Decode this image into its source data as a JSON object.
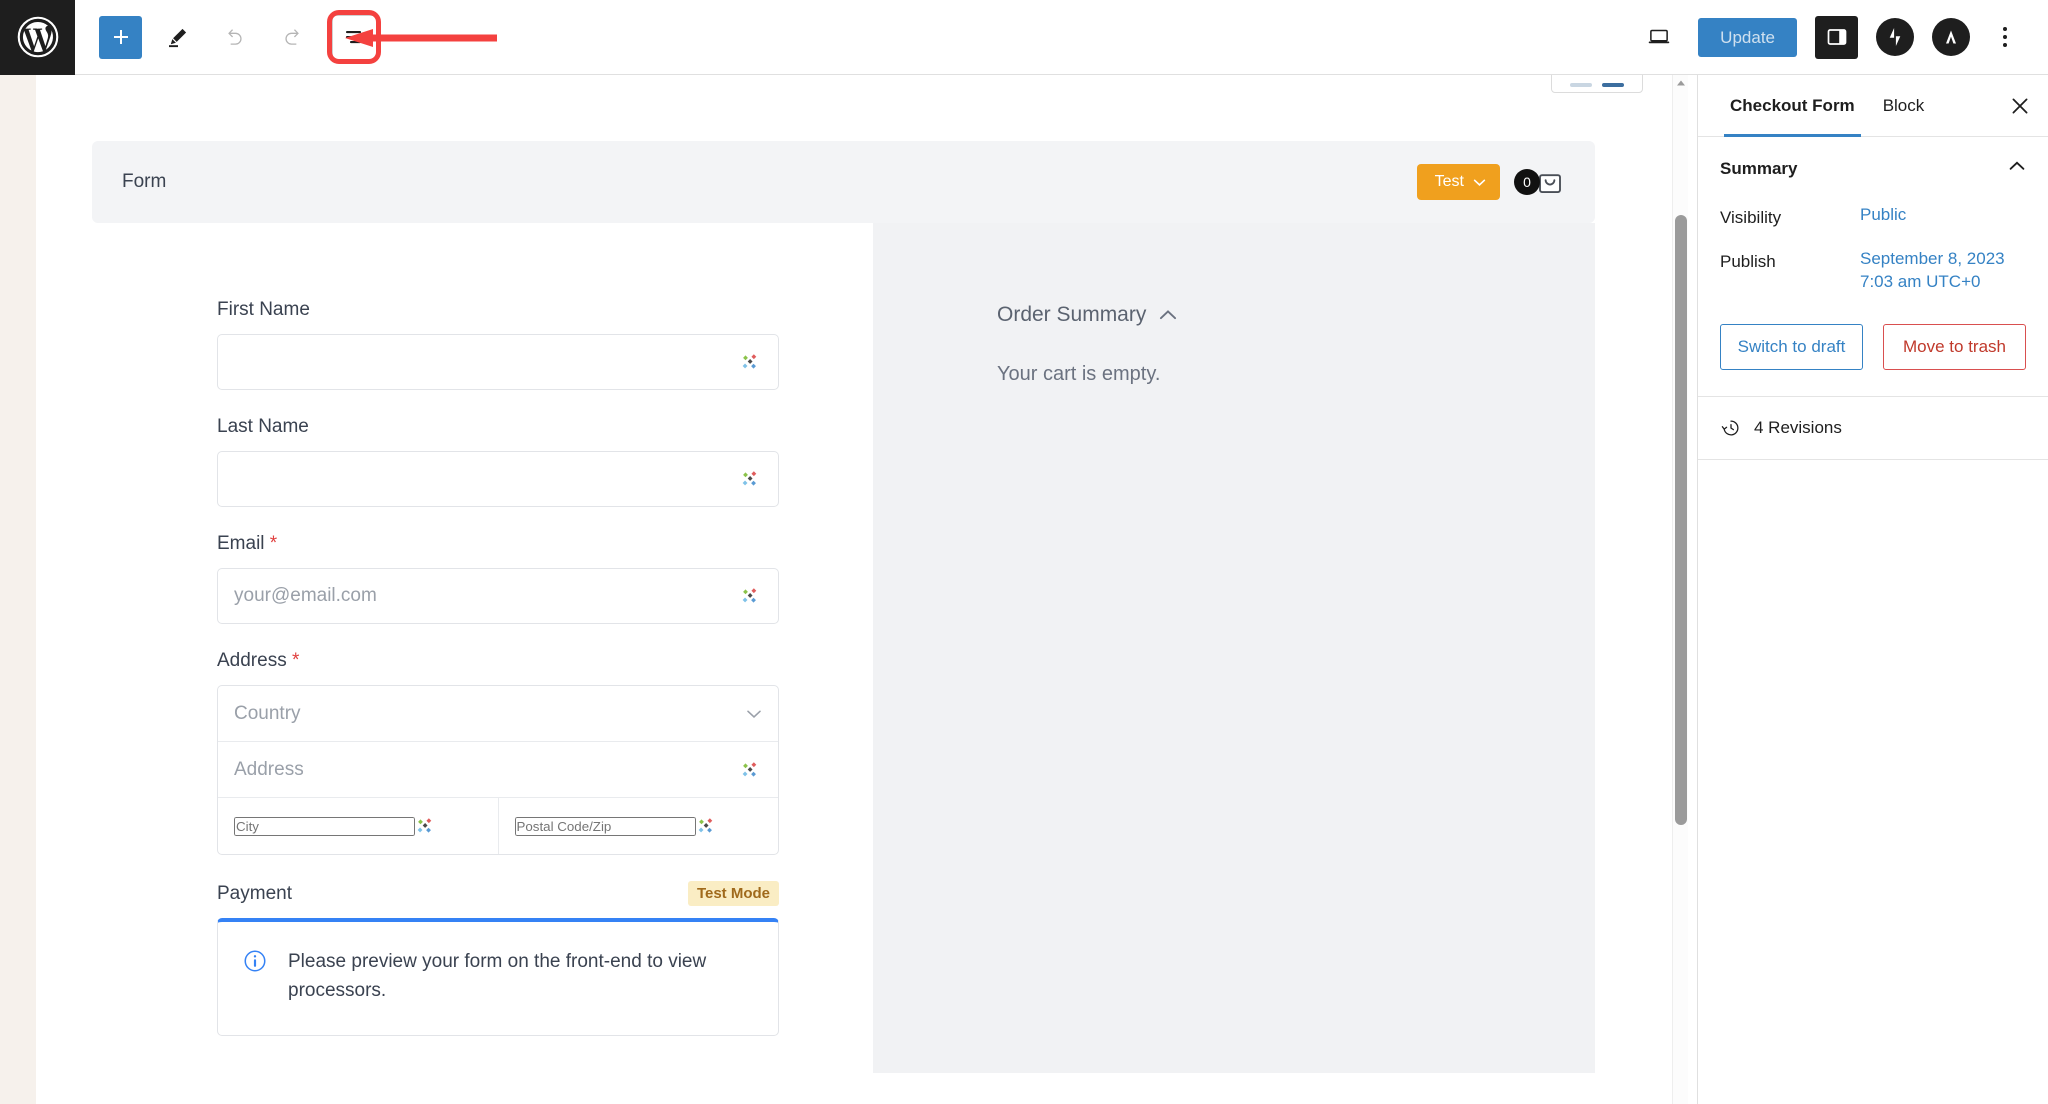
{
  "topbar": {
    "logo_icon": "wordpress-logo-icon",
    "add_block_label": "+",
    "add_block_icon": "plus-icon",
    "edit_icon": "pencil-icon",
    "undo_icon": "undo-arrow-icon",
    "redo_icon": "redo-arrow-icon",
    "list_view_icon": "document-overview-list-view-icon",
    "preview_icon": "laptop-preview-icon",
    "update_label": "Update",
    "settings_icon": "settings-sidebar-panel-icon",
    "jetpack_icon": "jetpack-icon",
    "plugin_icon": "triangle-plugin-icon",
    "options_icon": "kebab-more-options-icon",
    "accent_blue": "#3582c4",
    "highlight_red": "#f4413f"
  },
  "annotation": {
    "arrow_icon": "red-left-pointing-arrow",
    "color": "#f4413f",
    "target": "list-view-button"
  },
  "form_block": {
    "title": "Form",
    "test_badge": "Test",
    "test_badge_chevron": "chevron-down-icon",
    "test_badge_color": "#f0a01e",
    "cart_count": "0",
    "cart_icon": "shopping-bag-icon"
  },
  "form_fields": [
    {
      "label": "First Name",
      "required": false,
      "value": "",
      "placeholder": "",
      "icon": "autofill-diamonds-icon"
    },
    {
      "label": "Last Name",
      "required": false,
      "value": "",
      "placeholder": "",
      "icon": "autofill-diamonds-icon"
    },
    {
      "label": "Email",
      "required": true,
      "value": "",
      "placeholder": "your@email.com",
      "icon": "autofill-diamonds-icon"
    }
  ],
  "address": {
    "label": "Address",
    "required": true,
    "country_placeholder": "Country",
    "country_chevron": "chevron-down-icon",
    "street_placeholder": "Address",
    "city_placeholder": "City",
    "postal_placeholder": "Postal Code/Zip",
    "autofill_icon": "autofill-diamonds-icon"
  },
  "payment": {
    "title": "Payment",
    "badge": "Test Mode",
    "badge_bg": "#faedc4",
    "badge_color": "#a06a1c",
    "notice_icon": "info-circle-icon",
    "notice_text": "Please preview your form on the front-end to view processors.",
    "notice_accent": "#3582f5"
  },
  "order_summary": {
    "title": "Order Summary",
    "collapse_icon": "chevron-up-icon",
    "empty_text": "Your cart is empty."
  },
  "sidebar": {
    "tabs": [
      {
        "label": "Checkout Form",
        "active": true
      },
      {
        "label": "Block",
        "active": false
      }
    ],
    "close_icon": "close-x-icon",
    "summary": {
      "title": "Summary",
      "collapse_icon": "chevron-up-icon",
      "rows": [
        {
          "label": "Visibility",
          "value": "Public"
        },
        {
          "label": "Publish",
          "value": "September 8, 2023 7:03 am UTC+0"
        }
      ]
    },
    "publish_date_line1": "September 8, 2023",
    "publish_date_line2": "7:03 am UTC+0",
    "switch_to_draft_label": "Switch to draft",
    "move_to_trash_label": "Move to trash",
    "revisions_label": "4 Revisions",
    "revisions_icon": "history-clock-icon"
  },
  "scrollbar": {
    "up_arrow_icon": "scroll-up-arrow-icon"
  }
}
